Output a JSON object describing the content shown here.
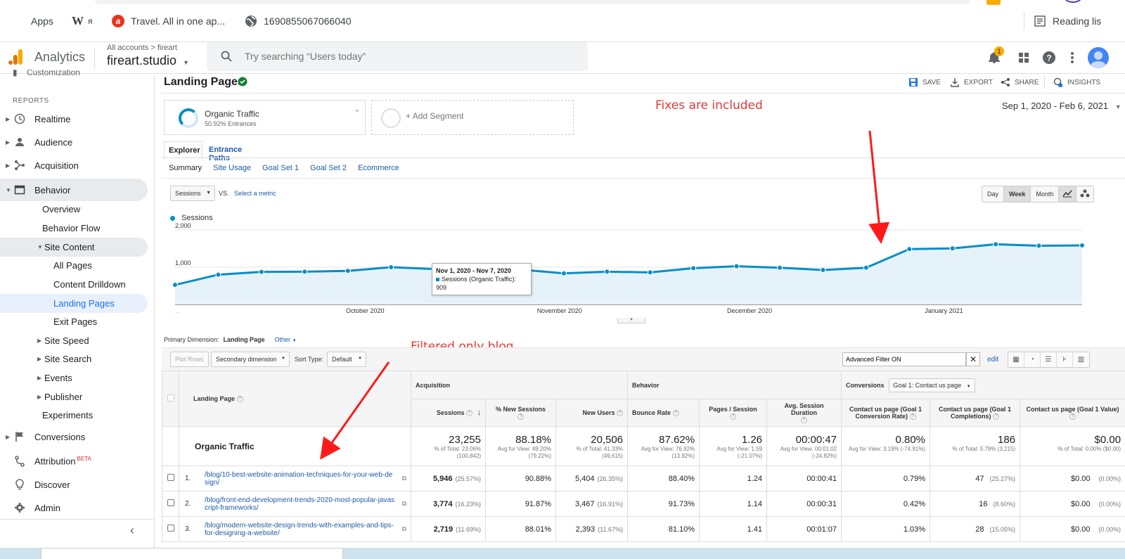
{
  "bookmarks": {
    "apps": "Apps",
    "wiki": "W",
    "wiki_suffix": "я",
    "travel": "Travel. All in one ap...",
    "number": "1690855067066040",
    "reading_list": "Reading lis"
  },
  "header": {
    "app_name": "Analytics",
    "breadcrumb": "All accounts > fireart",
    "account": "fireart.studio",
    "search_placeholder": "Try searching “Users today”",
    "notification_count": "1"
  },
  "sidebar": {
    "section": "REPORTS",
    "items": [
      {
        "label": "Realtime"
      },
      {
        "label": "Audience"
      },
      {
        "label": "Acquisition"
      },
      {
        "label": "Behavior"
      }
    ],
    "behavior_sub": [
      "Overview",
      "Behavior Flow",
      "Site Content"
    ],
    "site_content_sub": [
      "All Pages",
      "Content Drilldown",
      "Landing Pages",
      "Exit Pages"
    ],
    "behavior_more": [
      "Site Speed",
      "Site Search",
      "Events",
      "Publisher"
    ],
    "experiments": "Experiments",
    "bottom": [
      "Conversions",
      "Attribution",
      "Discover",
      "Admin"
    ],
    "beta": "BETA"
  },
  "report": {
    "title": "Landing Pages",
    "toolbar": {
      "save": "SAVE",
      "export": "EXPORT",
      "share": "SHARE",
      "insights": "INSIGHTS"
    },
    "segment": {
      "name": "Organic Traffic",
      "sub": "50.92% Entrances",
      "add": "+ Add Segment"
    },
    "date_range": "Sep 1, 2020 - Feb 6, 2021",
    "tabs": [
      "Explorer",
      "Entrance Paths"
    ],
    "subtabs": [
      "Summary",
      "Site Usage",
      "Goal Set 1",
      "Goal Set 2",
      "Ecommerce"
    ],
    "metric": "Sessions",
    "vs": "VS.",
    "select_metric": "Select a metric",
    "granularity": [
      "Day",
      "Week",
      "Month"
    ],
    "legend": "Sessions"
  },
  "annotations": {
    "fixes": "Fixes are included",
    "filtered": "Filtered only blog"
  },
  "chart_data": {
    "type": "area",
    "series": [
      {
        "name": "Sessions",
        "values": [
          525,
          800,
          875,
          880,
          900,
          1000,
          950,
          909,
          935,
          835,
          880,
          860,
          975,
          1025,
          985,
          925,
          985,
          1485,
          1505,
          1615,
          1575,
          1585
        ]
      }
    ],
    "x_ticks": [
      "October 2020",
      "November 2020",
      "December 2020",
      "January 2021"
    ],
    "y_ticks": [
      "2,000",
      "1,000"
    ],
    "ylim": [
      0,
      2000
    ],
    "first_label": "...",
    "tooltip": {
      "title": "Nov 1, 2020 - Nov 7, 2020",
      "text": "Sessions (Organic Traffic): 909"
    }
  },
  "table": {
    "primary_dimension_label": "Primary Dimension:",
    "primary_dimension": "Landing Page",
    "other": "Other",
    "plot_rows": "Plot Rows",
    "secondary_dimension": "Secondary dimension",
    "sort_type_label": "Sort Type:",
    "sort_type": "Default",
    "advanced_filter": "Advanced Filter ON",
    "edit": "edit",
    "groups": {
      "acquisition": "Acquisition",
      "behavior": "Behavior",
      "conversions": "Conversions",
      "goal": "Goal 1: Contact us page"
    },
    "columns": [
      "Landing Page",
      "Sessions",
      "% New Sessions",
      "New Users",
      "Bounce Rate",
      "Pages / Session",
      "Avg. Session Duration",
      "Contact us page (Goal 1 Conversion Rate)",
      "Contact us page (Goal 1 Completions)",
      "Contact us page (Goal 1 Value)"
    ],
    "totals": {
      "label": "Organic Traffic",
      "sessions": "23,255",
      "sessions_sub": "% of Total: 23.06% (100,842)",
      "new_sessions": "88.18%",
      "new_sessions_sub": "Avg for View: 49.20% (79.22%)",
      "new_users": "20,506",
      "new_users_sub": "% of Total: 41.33% (49,615)",
      "bounce": "87.62%",
      "bounce_sub": "Avg for View: 76.92% (13.92%)",
      "pps": "1.26",
      "pps_sub": "Avg for View: 1.59 (-21.07%)",
      "duration": "00:00:47",
      "duration_sub": "Avg for View: 00:01:02 (-24.82%)",
      "conv_rate": "0.80%",
      "conv_rate_sub": "Avg for View: 3.19% (-74.91%)",
      "completions": "186",
      "completions_sub": "% of Total: 5.79% (3,215)",
      "value": "$0.00",
      "value_sub": "% of Total: 0.00% ($0.00)"
    },
    "rows": [
      {
        "num": "1.",
        "page": "/blog/10-best-website-animation-techniques-for-your-web-design/",
        "sessions": "5,946",
        "sessions_pct": "(25.57%)",
        "new_sessions": "90.88%",
        "new_users": "5,404",
        "new_users_pct": "(26.35%)",
        "bounce": "88.40%",
        "pps": "1.24",
        "duration": "00:00:41",
        "conv": "0.79%",
        "completions": "47",
        "completions_pct": "(25.27%)",
        "value": "$0.00",
        "value_pct": "(0.00%)"
      },
      {
        "num": "2.",
        "page": "/blog/front-end-development-trends-2020-most-popular-javascript-frameworks/",
        "sessions": "3,774",
        "sessions_pct": "(16.23%)",
        "new_sessions": "91.87%",
        "new_users": "3,467",
        "new_users_pct": "(16.91%)",
        "bounce": "91.73%",
        "pps": "1.14",
        "duration": "00:00:31",
        "conv": "0.42%",
        "completions": "16",
        "completions_pct": "(8.60%)",
        "value": "$0.00",
        "value_pct": "(0.00%)"
      },
      {
        "num": "3.",
        "page": "/blog/modern-website-design-trends-with-examples-and-tips-for-designing-a-website/",
        "sessions": "2,719",
        "sessions_pct": "(11.69%)",
        "new_sessions": "88.01%",
        "new_users": "2,393",
        "new_users_pct": "(11.67%)",
        "bounce": "81.10%",
        "pps": "1.41",
        "duration": "00:01:07",
        "conv": "1.03%",
        "completions": "28",
        "completions_pct": "(15.05%)",
        "value": "$0.00",
        "value_pct": "(0.00%)"
      }
    ]
  },
  "colors": {
    "ga_orange": "#f9ab00",
    "ga_dark_orange": "#e37400",
    "line": "#058dc7",
    "link": "#1d5ba6",
    "annotation": "#e53935"
  }
}
